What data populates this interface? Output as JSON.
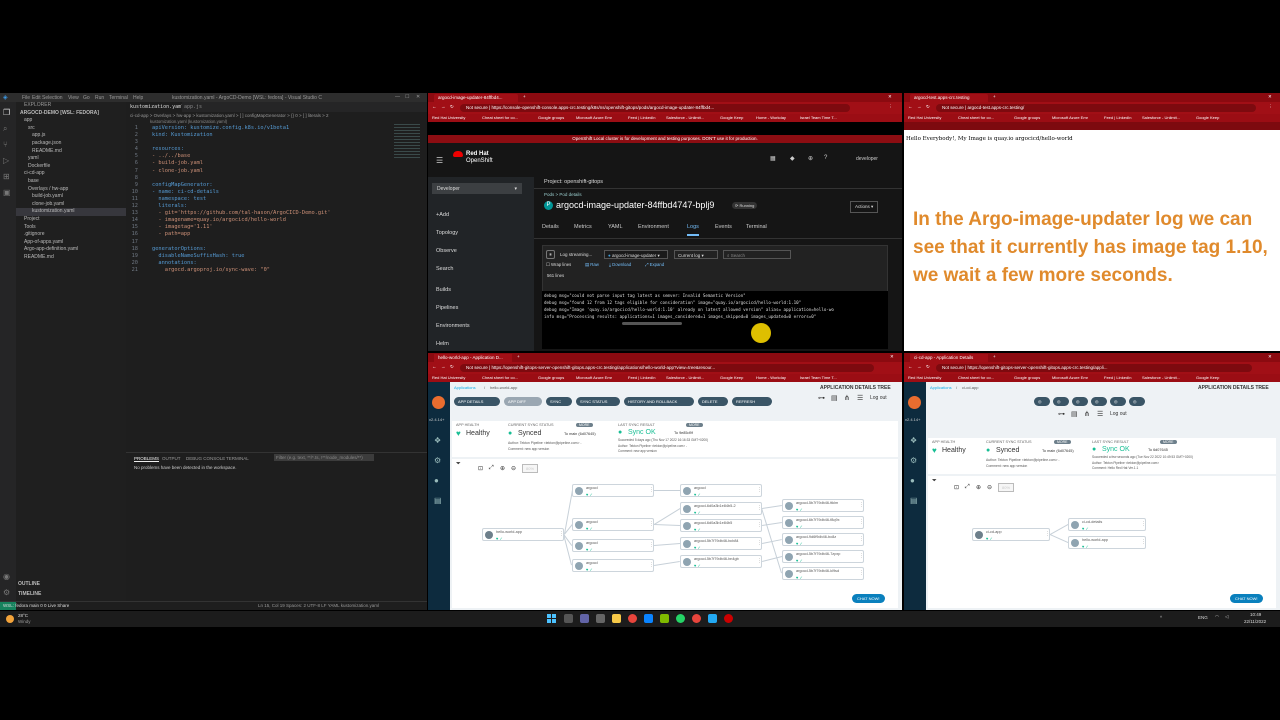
{
  "vscode": {
    "title": "kustomization.yaml - ArgoCD-Demo [WSL: fedora] - Visual Studio Code",
    "menu": [
      "File",
      "Edit",
      "Selection",
      "View",
      "Go",
      "Run",
      "Terminal",
      "Help"
    ],
    "explorer_label": "EXPLORER",
    "workspace": "ARGOCD-DEMO [WSL: FEDORA]",
    "tree": [
      "app",
      "src",
      "app.js",
      "package.json",
      "README.md",
      "yaml",
      "Dockerfile",
      "ci-cd-app",
      "base",
      "Overlays / hw-app",
      "build-job.yaml",
      "clone-job.yaml",
      "kustomization.yaml",
      "Project",
      "Tools",
      ".gitignore",
      "App-of-apps.yaml",
      "Argo-app-definition.yaml",
      "README.md"
    ],
    "outline": "OUTLINE",
    "timeline": "TIMELINE",
    "tabs": [
      "kustomization.yaml",
      "app.js"
    ],
    "breadcrumb": "ci-cd-app > Overlays > hw-app > kustomization.yaml > [ ] configMapGenerator > {} 0 > [ ] literals > 2",
    "schema_note": "kustomization.yaml (kustomization.yaml)",
    "code": [
      "apiVersion: kustomize.config.k8s.io/v1beta1",
      "kind: Kustomization",
      "",
      "resources:",
      "- ../../base",
      "- build-job.yaml",
      "- clone-job.yaml",
      "",
      "configMapGenerator:",
      "- name: ci-cd-details",
      "  namespace: test",
      "  literals:",
      "  - git='https://github.com/tal-hason/ArgoCICD-Demo.git'",
      "  - imagename=quay.io/argocicd/hello-world",
      "  - imagetag='1.11'",
      "  - path=app",
      "",
      "generatorOptions:",
      "  disableNameSuffixHash: true",
      "  annotations:",
      "    argocd.argoproj.io/sync-wave: \"0\""
    ],
    "panel_tabs": [
      "PROBLEMS",
      "OUTPUT",
      "DEBUG CONSOLE",
      "TERMINAL"
    ],
    "filter_placeholder": "Filter (e.g. text, **/*.ts, !**/node_modules/**)",
    "problems_msg": "No problems have been detected in the workspace.",
    "status_left": "WSL: fedora    main    0 0    Live Share",
    "status_right": "Ln 15, Col 19   Spaces: 2   UTF-8   LF   YAML   kustomization.yaml"
  },
  "openshift": {
    "tab": "argocd-image-updater-84ffbd4...",
    "url": "https://console-openshift-console.apps-crc.testing/k8s/ns/openshift-gitops/pods/argocd-image-updater-84ffbd4...",
    "not_secure": "Not secure",
    "bookmarks": [
      "Red Hat University",
      "Cheat sheet for co...",
      "Google groups",
      "Microsoft Azure Emr",
      "Feed | LinkedIn",
      "Salesforce - Unlimit...",
      "Google Keep",
      "Home - Workday",
      "Israel Team Time T..."
    ],
    "warning": "OpenShift Local cluster is for development and testing purposes. DON'T use it for production.",
    "brand1": "Red Hat",
    "brand2": "OpenShift",
    "user": "developer",
    "perspective": "Developer",
    "nav": [
      "+Add",
      "Topology",
      "Observe",
      "Search",
      "Builds",
      "Pipelines",
      "Environments",
      "Helm"
    ],
    "project": "Project: openshift-gitops",
    "breadcrumb": "Pods  >  Pod details",
    "pod_badge": "P",
    "pod_name": "argocd-image-updater-84ffbd4747-bplj9",
    "pod_status": "Running",
    "actions": "Actions",
    "tabs": [
      "Details",
      "Metrics",
      "YAML",
      "Environment",
      "Logs",
      "Events",
      "Terminal"
    ],
    "log_streaming": "Log streaming...",
    "container": "argocd-image-updater",
    "log_select": "Current log",
    "search_placeholder": "Search",
    "wrap_lines": "Wrap lines",
    "raw": "Raw",
    "download": "Download",
    "expand": "Expand",
    "line_count": "561 lines",
    "log_lines": [
      "debug msg=\"could not parse input tag latest as semver: Invalid Semantic Version\"",
      "debug msg=\"found 12 from 12 tags eligible for consideration\" image=\"quay.io/argocicd/hello-world:1.10\"",
      "debug msg=\"Image 'quay.io/argocicd/hello-world:1.10' already on latest allowed version\" alias= application=hello-wo",
      "info msg=\"Processing results: applications=1 images_considered=1 images_skipped=0 images_updated=0 errors=0\""
    ]
  },
  "hello": {
    "tab": "argocd-test.apps-crc.testing",
    "url": "argocd-test.apps-crc.testing/",
    "not_secure": "Not secure",
    "bookmarks": [
      "Red Hat University",
      "Cheat sheet for co...",
      "Google groups",
      "Microsoft Azure Emr",
      "Feed | LinkedIn",
      "Salesforce - Unlimit...",
      "Google Keep"
    ],
    "page_text": "Hello Everybody!, My Image is quay.io argocicd/hello-world",
    "overlay": "In the Argo-image-updater log we can see that it currently has image tag 1.10, we wait a few more seconds.",
    "overlay_color": "#e08a2c"
  },
  "argo_left": {
    "tab": "hello-world-app - Application D...",
    "url": "https://openshift-gitops-server-openshift-gitops.apps-crc.testing/applications/hello-world-app?view=tree&resour...",
    "not_secure": "Not secure",
    "bookmarks": [
      "Red Hat University",
      "Cheat sheet for co...",
      "Google groups",
      "Microsoft Azure Emr",
      "Feed | LinkedIn",
      "Salesforce - Unlimit...",
      "Google Keep",
      "Home - Workday",
      "Israel Team Time T..."
    ],
    "version": "v2.4.14+",
    "crumb1": "Applications",
    "crumb2": "hello-world-app",
    "header": "APPLICATION DETAILS TREE",
    "buttons": [
      "APP DETAILS",
      "APP DIFF",
      "SYNC",
      "SYNC STATUS",
      "HISTORY AND ROLLBACK",
      "DELETE",
      "REFRESH"
    ],
    "logout": "Log out",
    "health_label": "APP HEALTH",
    "health": "Healthy",
    "sync_label": "CURRENT SYNC STATUS",
    "sync": "Synced",
    "sync_to": "To main (6d07645)",
    "more": "MORE",
    "author_line": "Author:    Tekton Pipeline <tekton@pipeline.com> -",
    "comment_line": "Comment:   new app version",
    "last_label": "LAST SYNC RESULT",
    "last": "Sync OK",
    "last_to": "To 9e85d9f",
    "last_detail": "Succeeded 5 days ago (Thu Nov 17 2022 16:16:33 GMT+0200)",
    "zoom": "80%",
    "nodes": [
      "hello-world-app",
      "argocd",
      "argocd",
      "argocd",
      "argocd",
      "argocd",
      "argocd-6d0a3b1e84b5-2",
      "argocd-6d0a3b1e84b5",
      "argocd-5b7f79db46-bcb84",
      "argocd-5b7f79db46-bn4gb",
      "argocd-5b7f79db46-ttklm",
      "argocd-6b7f79db46-f8q9x",
      "argocd-9d6f9db46-bc8z",
      "argocd-5b7f79db46-7zpxp",
      "argocd-5b7f79db46-kl9sd"
    ],
    "chat": "CHAT NOW!"
  },
  "argo_right": {
    "tab": "ci-cd-app - Application Details",
    "url": "https://openshift-gitops-server-openshift-gitops.apps-crc.testing/appli...",
    "not_secure": "Not secure",
    "bookmarks": [
      "Red Hat University",
      "Cheat sheet for co...",
      "Google groups",
      "Microsoft Azure Emr",
      "Feed | LinkedIn",
      "Salesforce - Unlimit...",
      "Google Keep"
    ],
    "version": "v2.4.14+",
    "crumb1": "Applications",
    "crumb2": "ci-cd-app",
    "header": "APPLICATION DETAILS TREE",
    "logout": "Log out",
    "health_label": "APP HEALTH",
    "health": "Healthy",
    "sync_label": "CURRENT SYNC STATUS",
    "sync": "Synced",
    "sync_to": "To main (6d07645)",
    "more": "MORE",
    "author_line": "Author:    Tekton Pipeline <tekton@pipeline.com> -",
    "comment_line": "Comment:   new app version",
    "last_label": "LAST SYNC RESULT",
    "last": "Sync OK",
    "last_to": "To 6d07645",
    "last_detail": "Succeeded a few seconds ago (Tue Nov 22 2022 10:49:53 GMT+0200)",
    "last_author": "Author:   Tekton Pipeline <tekton@pipeline.com>",
    "last_comment": "Comment:  Hello Red Hat Ver.1.1",
    "zoom": "80%",
    "nodes": [
      "ci-cd-app",
      "ci-cd-details",
      "hello-world-app"
    ],
    "chat": "CHAT NOW!"
  },
  "taskbar": {
    "weather_temp": "28°C",
    "weather_desc": "Windy",
    "lang": "ENG",
    "time": "10:49",
    "date": "22/11/2022"
  }
}
